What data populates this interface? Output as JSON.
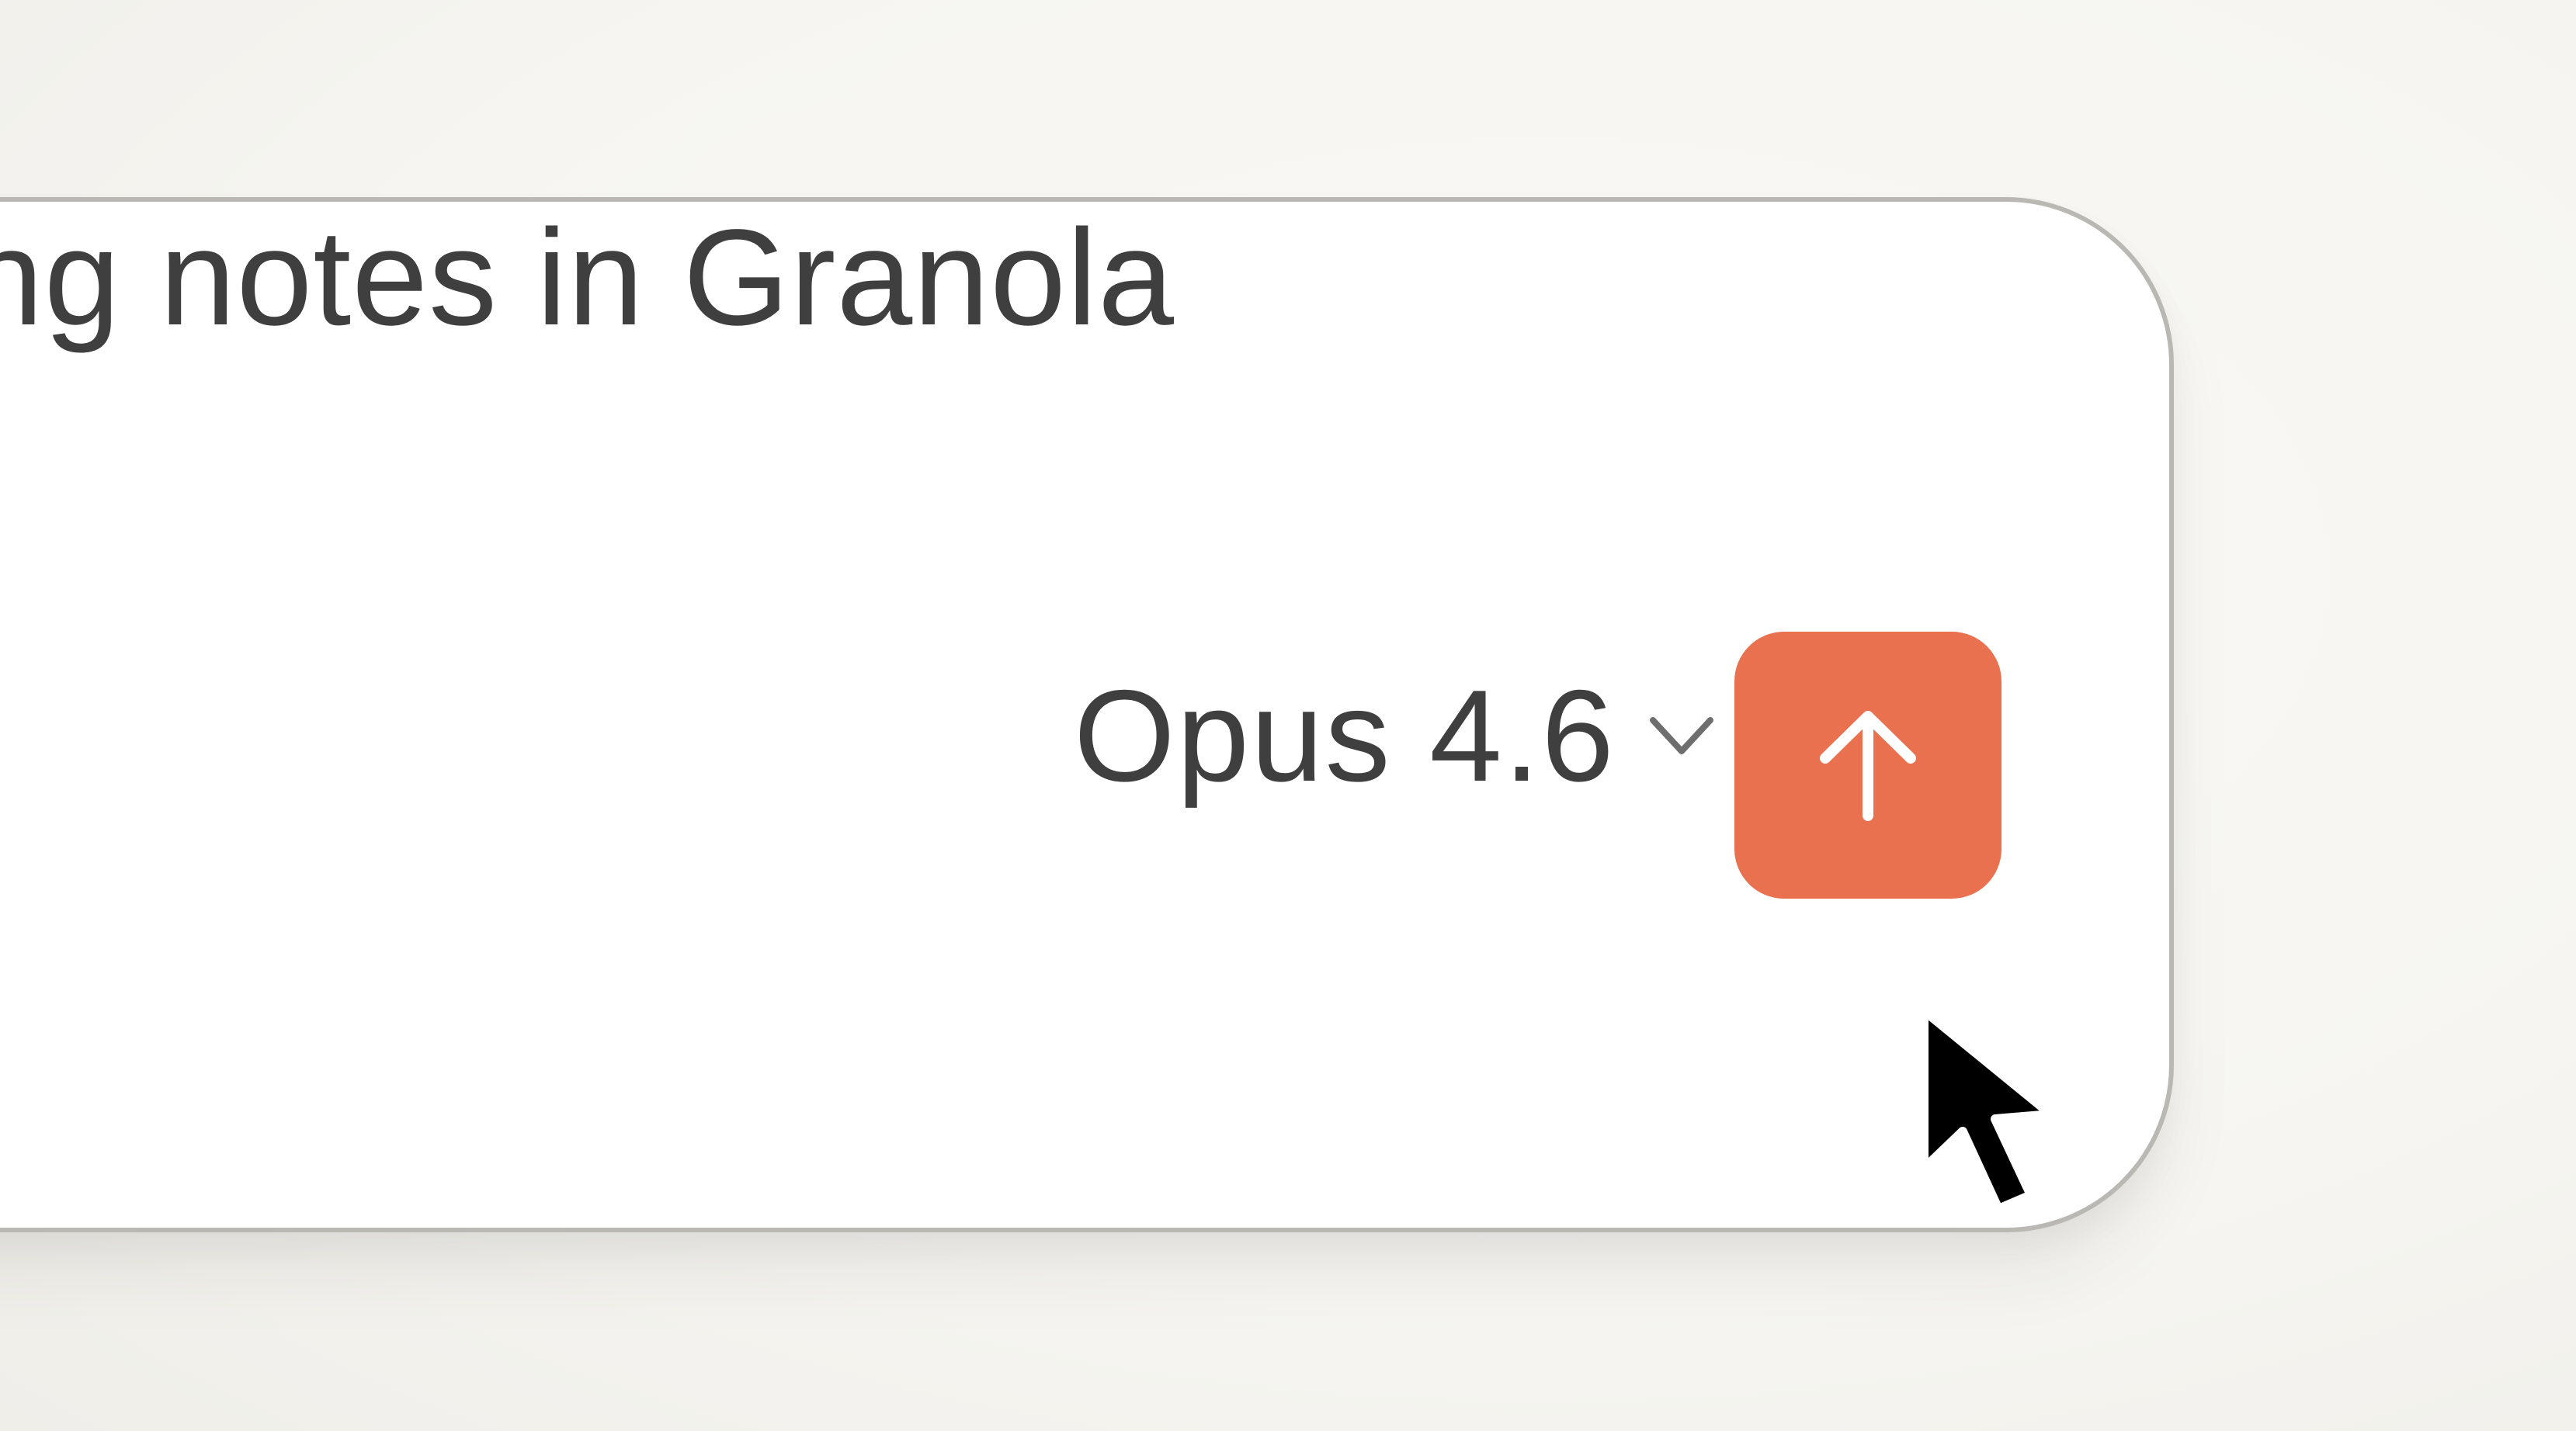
{
  "composer": {
    "prompt_text": "ing notes in Granola",
    "model_label": "Opus 4.6",
    "model_chevron_icon": "chevron-down-icon",
    "send_icon": "arrow-up-icon"
  },
  "cursor": {
    "icon": "mouse-pointer-icon"
  },
  "colors": {
    "send_button": "#e97150",
    "text": "#3f3f3f",
    "background": "#f8f7f3",
    "border": "#b9b8b3"
  }
}
